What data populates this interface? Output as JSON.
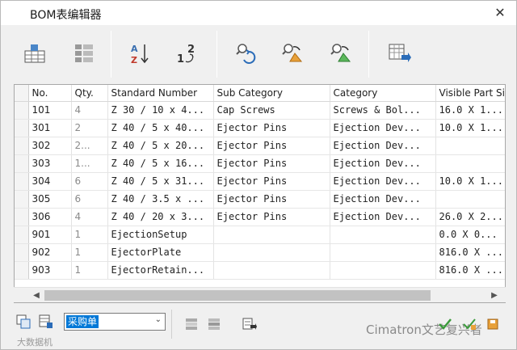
{
  "window": {
    "title": "BOM表编辑器",
    "close_glyph": "✕"
  },
  "toolbar": {
    "buttons": [
      {
        "name": "insert-row-icon"
      },
      {
        "name": "group-rows-icon"
      },
      {
        "name": "sort-az-icon"
      },
      {
        "name": "renumber-icon"
      },
      {
        "name": "refresh-search-icon"
      },
      {
        "name": "update-color-icon"
      },
      {
        "name": "update-green-icon"
      },
      {
        "name": "export-table-icon"
      }
    ]
  },
  "table": {
    "columns": [
      "No.",
      "Qty.",
      "Standard Number",
      "Sub Category",
      "Category",
      "Visible Part Siz"
    ],
    "rows": [
      [
        "101",
        "4",
        "Z 30 / 10 x 4...",
        "Cap Screws",
        "Screws & Bol...",
        "16.0 X 1..."
      ],
      [
        "301",
        "2",
        "Z 40 / 5 x 40...",
        "Ejector Pins",
        "Ejection Dev...",
        "10.0 X 1..."
      ],
      [
        "302",
        "2...",
        "Z 40 / 5 x 20...",
        "Ejector Pins",
        "Ejection Dev...",
        ""
      ],
      [
        "303",
        "1...",
        "Z 40 / 5 x 16...",
        "Ejector Pins",
        "Ejection Dev...",
        ""
      ],
      [
        "304",
        "6",
        "Z 40 / 5 x 31...",
        "Ejector Pins",
        "Ejection Dev...",
        "10.0 X 1..."
      ],
      [
        "305",
        "6",
        "Z 40 / 3.5 x ...",
        "Ejector Pins",
        "Ejection Dev...",
        ""
      ],
      [
        "306",
        "4",
        "Z 40 / 20 x 3...",
        "Ejector Pins",
        "Ejection Dev...",
        "26.0 X 2..."
      ],
      [
        "901",
        "1",
        "EjectionSetup",
        "",
        "",
        "0.0 X 0..."
      ],
      [
        "902",
        "1",
        "EjectorPlate",
        "",
        "",
        "816.0 X ..."
      ],
      [
        "903",
        "1",
        "EjectorRetain...",
        "",
        "",
        "816.0 X ..."
      ]
    ]
  },
  "bottom": {
    "combo_value": "采购单",
    "watermark_left": "大数据机",
    "watermark_right": "Cimatron文艺复兴者"
  }
}
